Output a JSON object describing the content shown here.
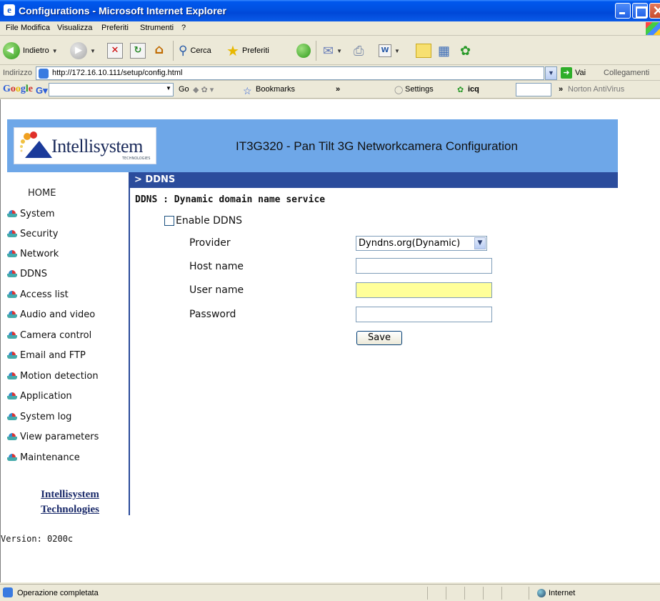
{
  "window": {
    "title": "Configurations - Microsoft Internet Explorer"
  },
  "menu": [
    "File",
    "Modifica",
    "Visualizza",
    "Preferiti",
    "Strumenti",
    "?"
  ],
  "toolbar": {
    "back_label": "Indietro",
    "search_label": "Cerca",
    "favorites_label": "Preferiti"
  },
  "address": {
    "label": "Indirizzo",
    "url": "http://172.16.10.111/setup/config.html",
    "go_label": "Vai",
    "links_label": "Collegamenti"
  },
  "googlebar": {
    "logo": "Google",
    "go_label": "Go",
    "bookmarks_label": "Bookmarks",
    "settings_label": "Settings",
    "icq_label": "icq",
    "norton_label": "Norton AntiVirus"
  },
  "banner": {
    "logo_text": "Intellisystem",
    "logo_sub": "TECHNOLOGIES",
    "title": "IT3G320 - Pan Tilt 3G Networkcamera Configuration"
  },
  "sidebar": {
    "home": "HOME",
    "items": [
      "System",
      "Security",
      "Network",
      "DDNS",
      "Access list",
      "Audio and video",
      "Camera control",
      "Email and FTP",
      "Motion detection",
      "Application",
      "System log",
      "View parameters",
      "Maintenance"
    ],
    "company_line1": "Intellisystem",
    "company_line2": "Technologies"
  },
  "page": {
    "section": "> DDNS",
    "heading": "DDNS : Dynamic domain name service",
    "enable_label": "Enable DDNS",
    "enable_checked": false,
    "provider_label": "Provider",
    "provider_value": "Dyndns.org(Dynamic)",
    "hostname_label": "Host name",
    "hostname_value": "",
    "username_label": "User name",
    "username_value": "",
    "password_label": "Password",
    "password_value": "",
    "save_label": "Save"
  },
  "version": "Version: 0200c",
  "status": {
    "text": "Operazione completata",
    "zone": "Internet"
  },
  "colors": {
    "banner": "#6EA7E8",
    "section_bar": "#2B4C9C",
    "highlight_input": "#FFFF99"
  }
}
